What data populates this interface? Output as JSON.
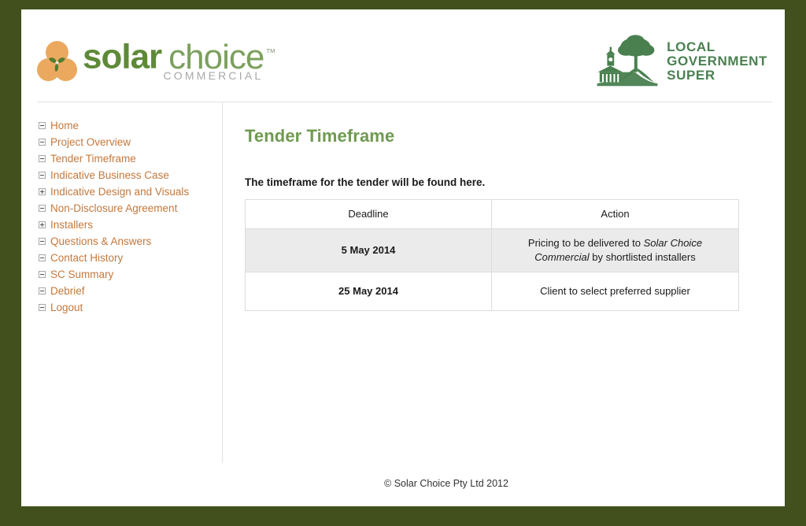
{
  "header": {
    "solar_choice_logo": {
      "word_solar": "solar",
      "word_choice": "choice",
      "trademark": "™",
      "subtitle": "COMMERCIAL",
      "mark_icon": "three-circles-leaf-icon"
    },
    "partner_logo": {
      "line1": "LOCAL",
      "line2": "GOVERNMENT",
      "line3": "SUPER",
      "mark_icon": "tree-and-town-hall-icon"
    }
  },
  "sidebar": {
    "items": [
      {
        "label": "Home",
        "icon": "minus-box-icon",
        "expandable": false
      },
      {
        "label": "Project Overview",
        "icon": "minus-box-icon",
        "expandable": false
      },
      {
        "label": "Tender Timeframe",
        "icon": "minus-box-icon",
        "expandable": false
      },
      {
        "label": "Indicative Business Case",
        "icon": "minus-box-icon",
        "expandable": false
      },
      {
        "label": "Indicative Design and Visuals",
        "icon": "plus-box-icon",
        "expandable": true
      },
      {
        "label": "Non-Disclosure Agreement",
        "icon": "minus-box-icon",
        "expandable": false
      },
      {
        "label": "Installers",
        "icon": "plus-box-icon",
        "expandable": true
      },
      {
        "label": "Questions & Answers",
        "icon": "minus-box-icon",
        "expandable": false
      },
      {
        "label": "Contact History",
        "icon": "minus-box-icon",
        "expandable": false
      },
      {
        "label": "SC Summary",
        "icon": "minus-box-icon",
        "expandable": false
      },
      {
        "label": "Debrief",
        "icon": "minus-box-icon",
        "expandable": false
      },
      {
        "label": "Logout",
        "icon": "minus-box-icon",
        "expandable": false
      }
    ]
  },
  "main": {
    "title": "Tender Timeframe",
    "intro": "The timeframe for the tender will be found here.",
    "table": {
      "columns": [
        "Deadline",
        "Action"
      ],
      "rows": [
        {
          "deadline": "5 May 2014",
          "action_prefix": "Pricing to be delivered to ",
          "action_emphasis": "Solar Choice Commercial",
          "action_suffix": " by shortlisted installers",
          "shaded": true
        },
        {
          "deadline": "25 May 2014",
          "action_prefix": "Client to select preferred supplier",
          "action_emphasis": "",
          "action_suffix": "",
          "shaded": false
        }
      ]
    }
  },
  "footer": {
    "copyright": "© Solar Choice Pty Ltd 2012"
  },
  "colors": {
    "page_border_green": "#41501c",
    "heading_green": "#6f9a50",
    "logo_green_bold": "#5e8a38",
    "logo_green_light": "#7ca05e",
    "logo_orange": "#eaa95f",
    "partner_green": "#4a8050",
    "nav_link_orange": "#c4783c",
    "table_shaded_row": "#ebebeb",
    "table_border": "#dcdcdc"
  }
}
